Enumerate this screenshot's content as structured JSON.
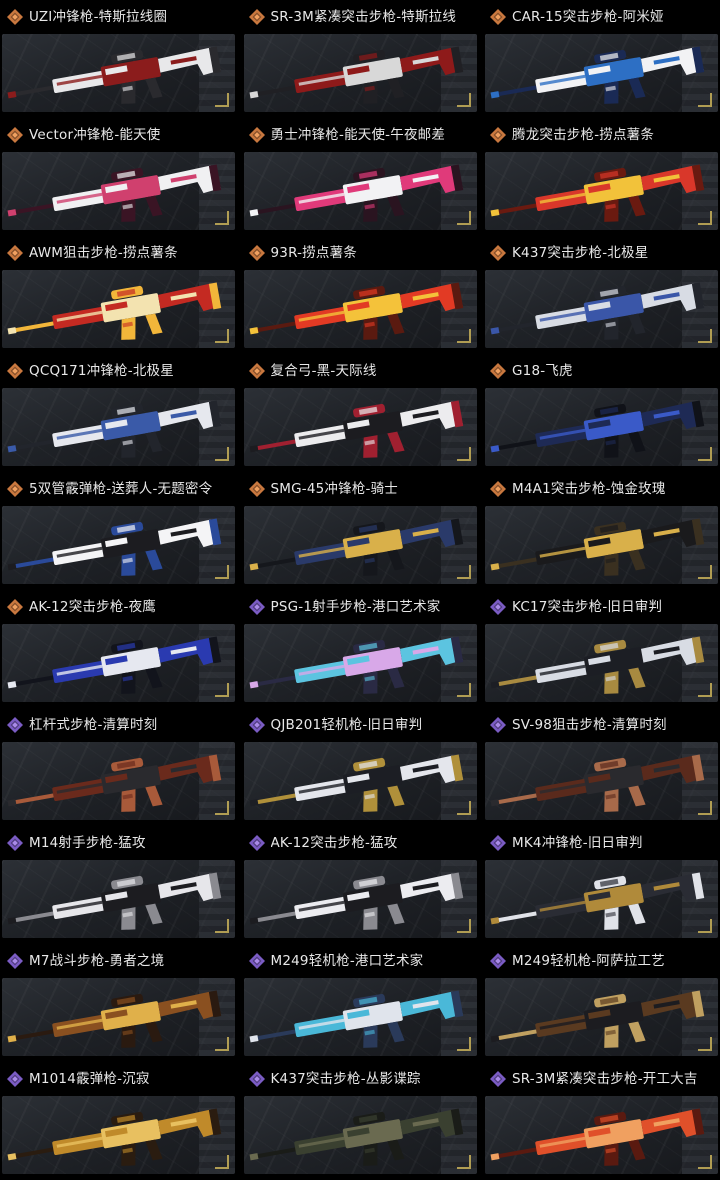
{
  "rarity_colors": {
    "orange": {
      "outer": "#c9783f",
      "inner": "#f0a060"
    },
    "purple": {
      "outer": "#7b5cc4",
      "inner": "#a98ae8"
    }
  },
  "items": [
    {
      "label": "UZI冲锋枪-特斯拉线圈",
      "rarity": "orange",
      "colors": [
        "#e8e8ea",
        "#8b1c1c",
        "#2a2a2e"
      ],
      "icon": "uzi-icon"
    },
    {
      "label": "SR-3M紧凑突击步枪-特斯拉线",
      "rarity": "orange",
      "colors": [
        "#8e1a1a",
        "#d8d8d8",
        "#202024"
      ],
      "icon": "sr3m-icon"
    },
    {
      "label": "CAR-15突击步枪-阿米娅",
      "rarity": "orange",
      "colors": [
        "#f2f2f4",
        "#2d6fc4",
        "#1a2a55"
      ],
      "icon": "car15-icon"
    },
    {
      "label": "Vector冲锋枪-能天使",
      "rarity": "orange",
      "colors": [
        "#f0f0f2",
        "#d0406e",
        "#3a1424"
      ],
      "icon": "vector-icon"
    },
    {
      "label": "勇士冲锋枪-能天使-午夜邮差",
      "rarity": "orange",
      "colors": [
        "#e03a7a",
        "#f2f2f4",
        "#2a1420"
      ],
      "icon": "warrior-smg-icon"
    },
    {
      "label": "腾龙突击步枪-捞点薯条",
      "rarity": "orange",
      "colors": [
        "#d9372a",
        "#f2c23a",
        "#6a1a10"
      ],
      "icon": "tenglong-icon"
    },
    {
      "label": "AWM狙击步枪-捞点薯条",
      "rarity": "orange",
      "colors": [
        "#c42a22",
        "#f3e3b0",
        "#f2b63a"
      ],
      "icon": "awm-icon"
    },
    {
      "label": "93R-捞点薯条",
      "rarity": "orange",
      "colors": [
        "#e23a24",
        "#f4c23a",
        "#5a1a10"
      ],
      "icon": "93r-icon"
    },
    {
      "label": "K437突击步枪-北极星",
      "rarity": "orange",
      "colors": [
        "#d8dce4",
        "#3a56a8",
        "#22252c"
      ],
      "icon": "k437-icon"
    },
    {
      "label": "QCQ171冲锋枪-北极星",
      "rarity": "orange",
      "colors": [
        "#e6e8ee",
        "#3a5aa8",
        "#22252c"
      ],
      "icon": "qcq171-icon"
    },
    {
      "label": "复合弓-黑-天际线",
      "rarity": "orange",
      "colors": [
        "#ececee",
        "#1c1c20",
        "#a02030"
      ],
      "icon": "bow-icon"
    },
    {
      "label": "G18-飞虎",
      "rarity": "orange",
      "colors": [
        "#1e2a55",
        "#3a5ac8",
        "#101218"
      ],
      "icon": "g18-icon"
    },
    {
      "label": "5双管霰弹枪-送葬人-无题密令",
      "rarity": "orange",
      "colors": [
        "#f4f4f6",
        "#1c1c20",
        "#2a4a9a"
      ],
      "icon": "shotgun-icon"
    },
    {
      "label": "SMG-45冲锋枪-骑士",
      "rarity": "orange",
      "colors": [
        "#2a3a6a",
        "#d9b04a",
        "#15171c"
      ],
      "icon": "smg45-icon"
    },
    {
      "label": "M4A1突击步枪-蚀金玫瑰",
      "rarity": "orange",
      "colors": [
        "#1a1a1c",
        "#d9b04a",
        "#3a3020"
      ],
      "icon": "m4a1-icon"
    },
    {
      "label": "AK-12突击步枪-夜鹰",
      "rarity": "orange",
      "colors": [
        "#2a3ab0",
        "#e6e8f0",
        "#12141c"
      ],
      "icon": "ak12-icon"
    },
    {
      "label": "PSG-1射手步枪-港口艺术家",
      "rarity": "purple",
      "colors": [
        "#5cc4e0",
        "#d8a8e8",
        "#2a2a44"
      ],
      "icon": "psg1-icon"
    },
    {
      "label": "KC17突击步枪-旧日审判",
      "rarity": "purple",
      "colors": [
        "#d8dce4",
        "#1c1e24",
        "#a88a40"
      ],
      "icon": "kc17-icon"
    },
    {
      "label": "杠杆式步枪-清算时刻",
      "rarity": "purple",
      "colors": [
        "#6a2a1c",
        "#2a2a2e",
        "#a85a3a"
      ],
      "icon": "lever-rifle-icon"
    },
    {
      "label": "QJB201轻机枪-旧日审判",
      "rarity": "purple",
      "colors": [
        "#e4e6ec",
        "#1c1e24",
        "#b0903a"
      ],
      "icon": "qjb201-icon"
    },
    {
      "label": "SV-98狙击步枪-清算时刻",
      "rarity": "purple",
      "colors": [
        "#5a2a1c",
        "#2a2a2e",
        "#a86a4a"
      ],
      "icon": "sv98-icon"
    },
    {
      "label": "M14射手步枪-猛攻",
      "rarity": "purple",
      "colors": [
        "#e6e6ea",
        "#1c1c20",
        "#8a8a90"
      ],
      "icon": "m14-icon"
    },
    {
      "label": "AK-12突击步枪-猛攻",
      "rarity": "purple",
      "colors": [
        "#ececf0",
        "#1c1c20",
        "#8a8a90"
      ],
      "icon": "ak12b-icon"
    },
    {
      "label": "MK4冲锋枪-旧日审判",
      "rarity": "purple",
      "colors": [
        "#2a2c34",
        "#b08a3a",
        "#e0e2e8"
      ],
      "icon": "mk4-icon"
    },
    {
      "label": "M7战斗步枪-勇者之境",
      "rarity": "purple",
      "colors": [
        "#8a5020",
        "#e0b04a",
        "#2a1a10"
      ],
      "icon": "m7-icon"
    },
    {
      "label": "M249轻机枪-港口艺术家",
      "rarity": "purple",
      "colors": [
        "#4ab8d8",
        "#e0e4ec",
        "#2a3a5a"
      ],
      "icon": "m249-icon"
    },
    {
      "label": "M249轻机枪-阿萨拉工艺",
      "rarity": "purple",
      "colors": [
        "#5a3a20",
        "#1c1c20",
        "#c0a060"
      ],
      "icon": "m249b-icon"
    },
    {
      "label": "M1014霰弹枪-沉寂",
      "rarity": "purple",
      "colors": [
        "#c08a2a",
        "#e8c060",
        "#2a1c10"
      ],
      "icon": "m1014-icon"
    },
    {
      "label": "K437突击步枪-丛影谍踪",
      "rarity": "purple",
      "colors": [
        "#3a4030",
        "#6a6a50",
        "#1a1c18"
      ],
      "icon": "k437b-icon"
    },
    {
      "label": "SR-3M紧凑突击步枪-开工大吉",
      "rarity": "purple",
      "colors": [
        "#e0502a",
        "#f0a060",
        "#5a1a10"
      ],
      "icon": "sr3mb-icon"
    }
  ]
}
